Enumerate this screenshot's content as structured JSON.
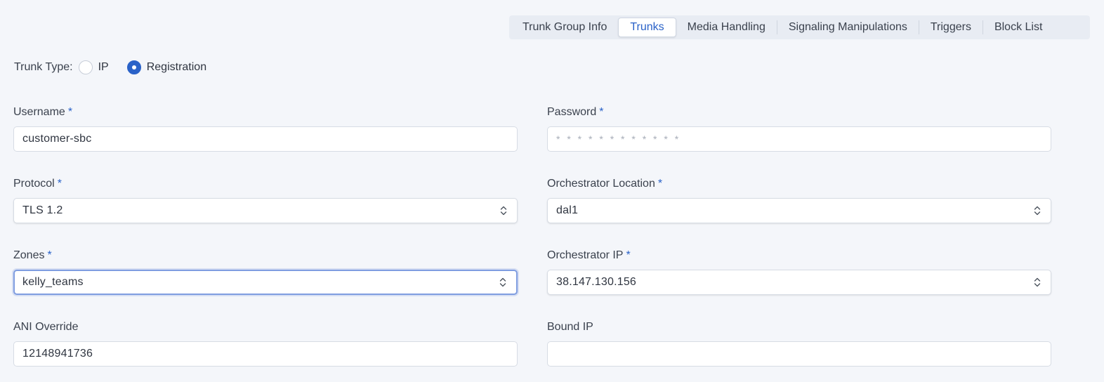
{
  "tabs": [
    {
      "label": "Trunk Group Info",
      "active": false
    },
    {
      "label": "Trunks",
      "active": true
    },
    {
      "label": "Media Handling",
      "active": false
    },
    {
      "label": "Signaling Manipulations",
      "active": false
    },
    {
      "label": "Triggers",
      "active": false
    },
    {
      "label": "Block List",
      "active": false
    }
  ],
  "trunk_type": {
    "label": "Trunk Type:",
    "options": [
      {
        "label": "IP",
        "checked": false
      },
      {
        "label": "Registration",
        "checked": true
      }
    ]
  },
  "fields": {
    "username": {
      "label": "Username",
      "required": "*",
      "value": "customer-sbc"
    },
    "password": {
      "label": "Password",
      "required": "*",
      "placeholder": "* * * * * * * * * * * *"
    },
    "protocol": {
      "label": "Protocol",
      "required": "*",
      "value": "TLS 1.2"
    },
    "orchestrator_location": {
      "label": "Orchestrator Location",
      "required": "*",
      "value": "dal1"
    },
    "zones": {
      "label": "Zones",
      "required": "*",
      "value": "kelly_teams"
    },
    "orchestrator_ip": {
      "label": "Orchestrator IP",
      "required": "*",
      "value": "38.147.130.156"
    },
    "ani_override": {
      "label": "ANI Override",
      "value": "12148941736"
    },
    "bound_ip": {
      "label": "Bound IP",
      "value": ""
    }
  },
  "colors": {
    "accent": "#2a62c8",
    "background": "#f4f6fa",
    "focus_border": "#7f9de0"
  }
}
